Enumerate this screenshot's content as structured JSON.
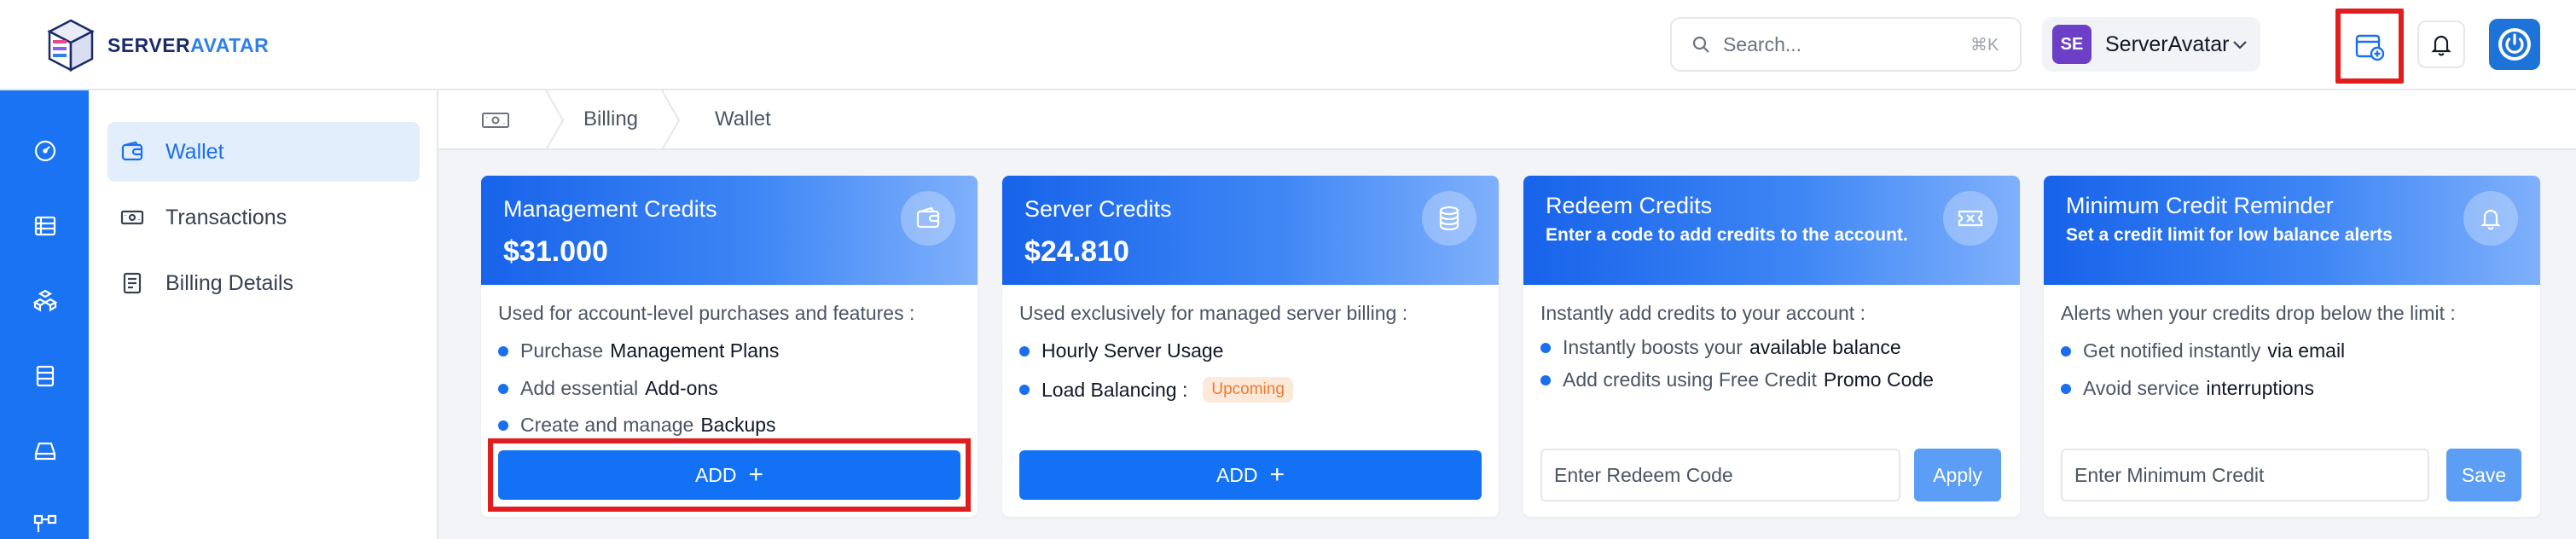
{
  "brand": {
    "name_part1": "SERVER",
    "name_part2": "AVATAR"
  },
  "search": {
    "placeholder": "Search...",
    "shortcut": "⌘K"
  },
  "account": {
    "initials": "SE",
    "name": "ServerAvatar"
  },
  "sidebar": {
    "items": [
      {
        "label": "Wallet",
        "icon": "wallet-icon",
        "active": true
      },
      {
        "label": "Transactions",
        "icon": "banknote-icon",
        "active": false
      },
      {
        "label": "Billing Details",
        "icon": "document-icon",
        "active": false
      }
    ]
  },
  "breadcrumb": {
    "items": [
      "Billing",
      "Wallet"
    ]
  },
  "cards": {
    "management": {
      "title": "Management Credits",
      "amount": "$31.000",
      "description": "Used for account-level purchases and features :",
      "bullets": [
        {
          "pre": "Purchase",
          "bold": "Management Plans"
        },
        {
          "pre": "Add essential",
          "bold": "Add-ons"
        },
        {
          "pre": "Create and manage",
          "bold": "Backups"
        }
      ],
      "button": "ADD"
    },
    "server": {
      "title": "Server Credits",
      "amount": "$24.810",
      "description": "Used exclusively for managed server billing :",
      "bullets": [
        {
          "bold": "Hourly Server Usage"
        },
        {
          "bold": "Load Balancing :",
          "badge": "Upcoming"
        }
      ],
      "button": "ADD"
    },
    "redeem": {
      "title": "Redeem Credits",
      "subtitle": "Enter a code to add credits to the account.",
      "description": "Instantly add credits to your account :",
      "bullets": [
        {
          "pre": "Instantly boosts your",
          "bold": "available balance"
        },
        {
          "pre": "Add credits using Free Credit",
          "bold": "Promo Code"
        }
      ],
      "input_placeholder": "Enter Redeem Code",
      "button": "Apply"
    },
    "reminder": {
      "title": "Minimum Credit Reminder",
      "subtitle": "Set a credit limit for low balance alerts",
      "description": "Alerts when your credits drop below the limit :",
      "bullets": [
        {
          "pre": "Get notified instantly",
          "bold": "via email"
        },
        {
          "pre": "Avoid service",
          "bold": "interruptions"
        }
      ],
      "input_placeholder": "Enter Minimum Credit",
      "button": "Save"
    }
  },
  "colors": {
    "primary": "#1371f5",
    "rail": "#1a73f2",
    "highlight": "#e11d1d",
    "badge_text": "#ef7a2f"
  }
}
